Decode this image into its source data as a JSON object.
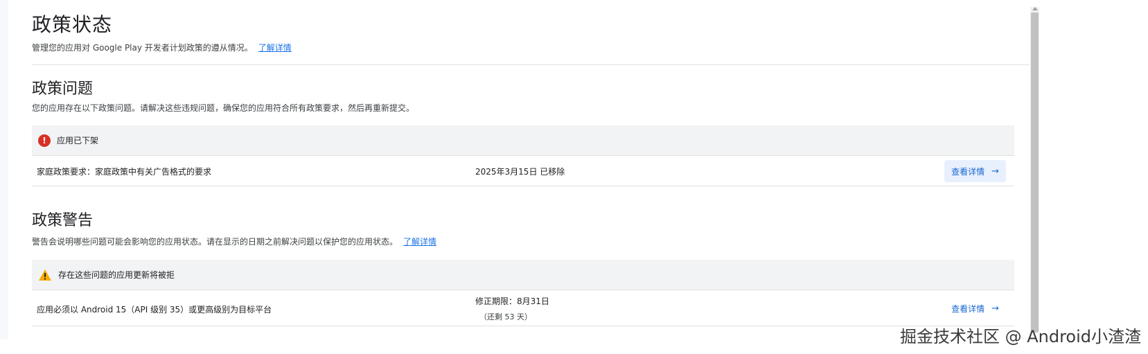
{
  "header": {
    "title": "政策状态",
    "subtitle": "管理您的应用对 Google Play 开发者计划政策的遵从情况。",
    "learn_more": "了解详情"
  },
  "issues": {
    "title": "政策问题",
    "description": "您的应用存在以下政策问题。请解决这些违规问题，确保您的应用符合所有政策要求，然后再重新提交。",
    "status_header": "应用已下架",
    "status_icon": "error-icon",
    "rows": [
      {
        "name": "家庭政策要求：家庭政策中有关广告格式的要求",
        "status": "2025年3月15日 已移除",
        "action": "查看详情"
      }
    ]
  },
  "warnings": {
    "title": "政策警告",
    "description": "警告会说明哪些问题可能会影响您的应用状态。请在显示的日期之前解决问题以保护您的应用状态。",
    "learn_more": "了解详情",
    "status_header": "存在这些问题的应用更新将被拒",
    "status_icon": "warning-icon",
    "rows": [
      {
        "name": "应用必须以 Android 15（API 级别 35）或更高级别为目标平台",
        "deadline": "修正期限：8月31日",
        "remaining": "（还剩 53 天）",
        "action": "查看详情"
      }
    ]
  },
  "watermark": "掘金技术社区 @ Android小渣渣",
  "colors": {
    "link": "#1a73e8",
    "error": "#d93025",
    "warning": "#f9ab00",
    "header_bg": "#f1f3f4"
  }
}
